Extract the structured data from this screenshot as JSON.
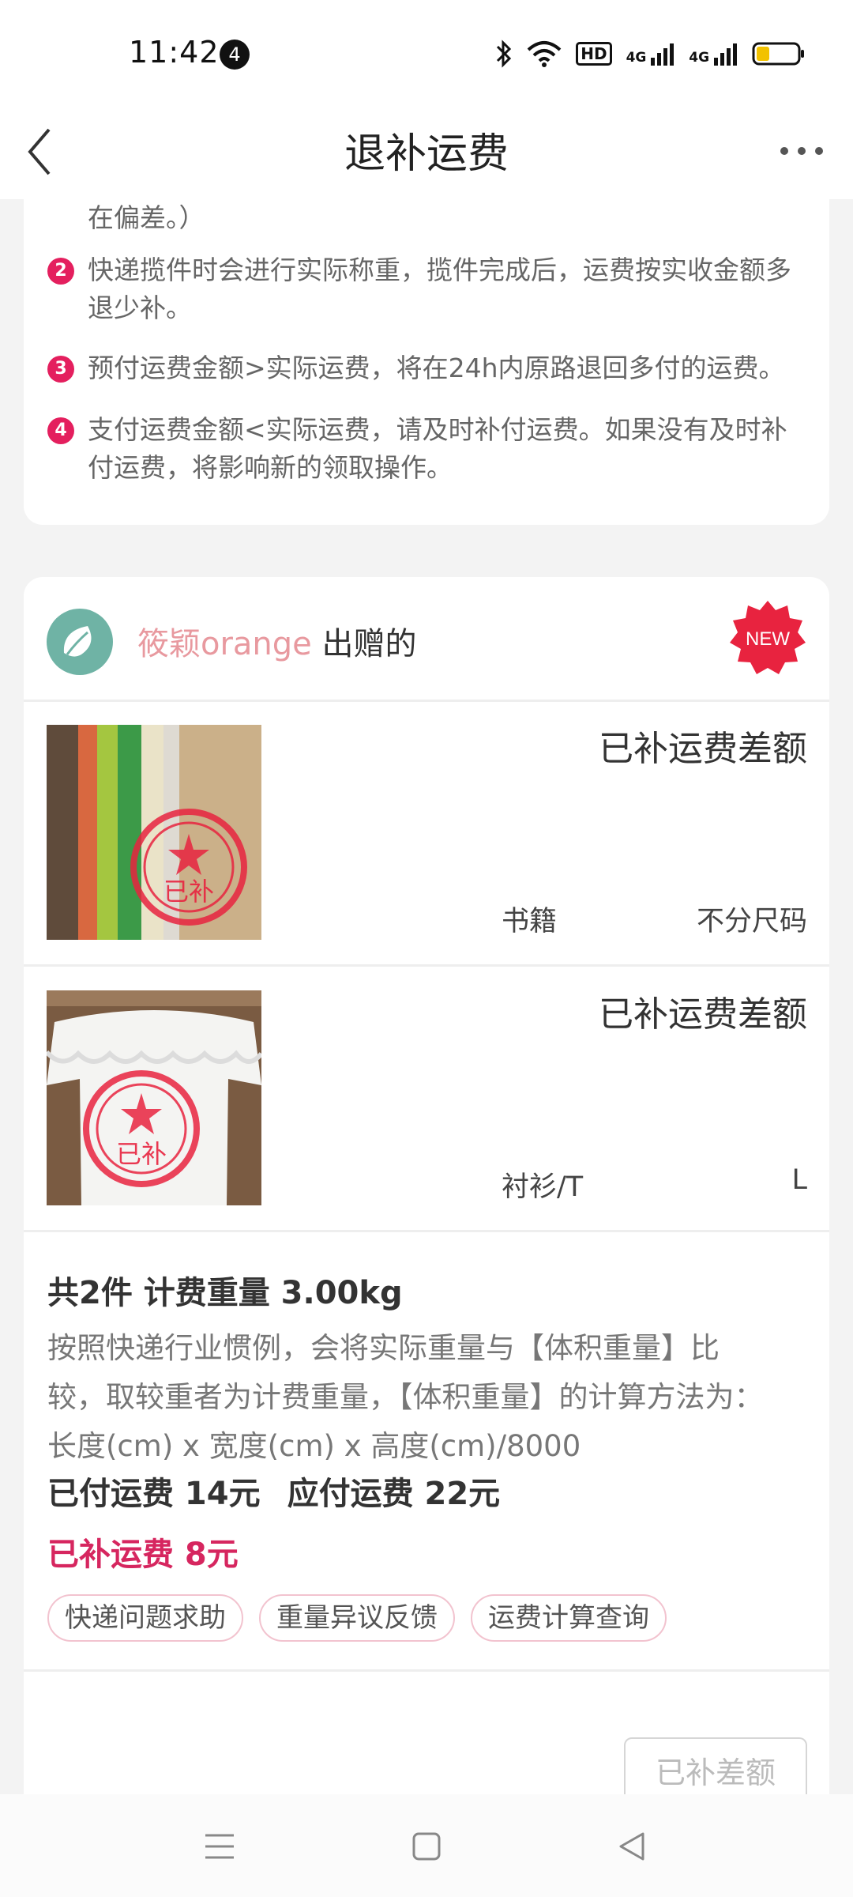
{
  "status_bar": {
    "time": "11:42",
    "notification_count": "4",
    "hd_label": "HD",
    "net1": "4G",
    "net2": "4G"
  },
  "nav": {
    "title": "退补运费"
  },
  "rules": [
    {
      "number": "",
      "text": "在偏差。）"
    },
    {
      "number": "2",
      "text": "快递揽件时会进行实际称重，揽件完成后，运费按实收金额多退少补。"
    },
    {
      "number": "3",
      "text": "预付运费金额>实际运费，将在24h内原路退回多付的运费。"
    },
    {
      "number": "4",
      "text": "支付运费金额<实际运费，请及时补付运费。如果没有及时补付运费，将影响新的领取操作。"
    }
  ],
  "giver": {
    "name": "筱颖orange",
    "suffix": " 出赠的",
    "badge": "NEW"
  },
  "items": [
    {
      "status": "已补运费差额",
      "category": "书籍",
      "size": "不分尺码",
      "stamp": "已补"
    },
    {
      "status": "已补运费差额",
      "category": "衬衫/T",
      "size": "L",
      "stamp": "已补"
    }
  ],
  "summary": {
    "title": "共2件 计费重量 3.00kg",
    "description": "按照快递行业惯例，会将实际重量与【体积重量】比较，取较重者为计费重量，【体积重量】的计算方法为：长度(cm) x 宽度(cm) x 高度(cm)/8000",
    "paid_fee": "已付运费 14元",
    "due_fee": "应付运费 22元",
    "supplemented": "已补运费 8元"
  },
  "chips": [
    "快递问题求助",
    "重量异议反馈",
    "运费计算查询"
  ],
  "action_button": "已补差额",
  "colors": {
    "accent": "#d6265f",
    "stamp": "#e8233f",
    "giver_name": "#e8999f",
    "avatar": "#6fb3a5"
  }
}
